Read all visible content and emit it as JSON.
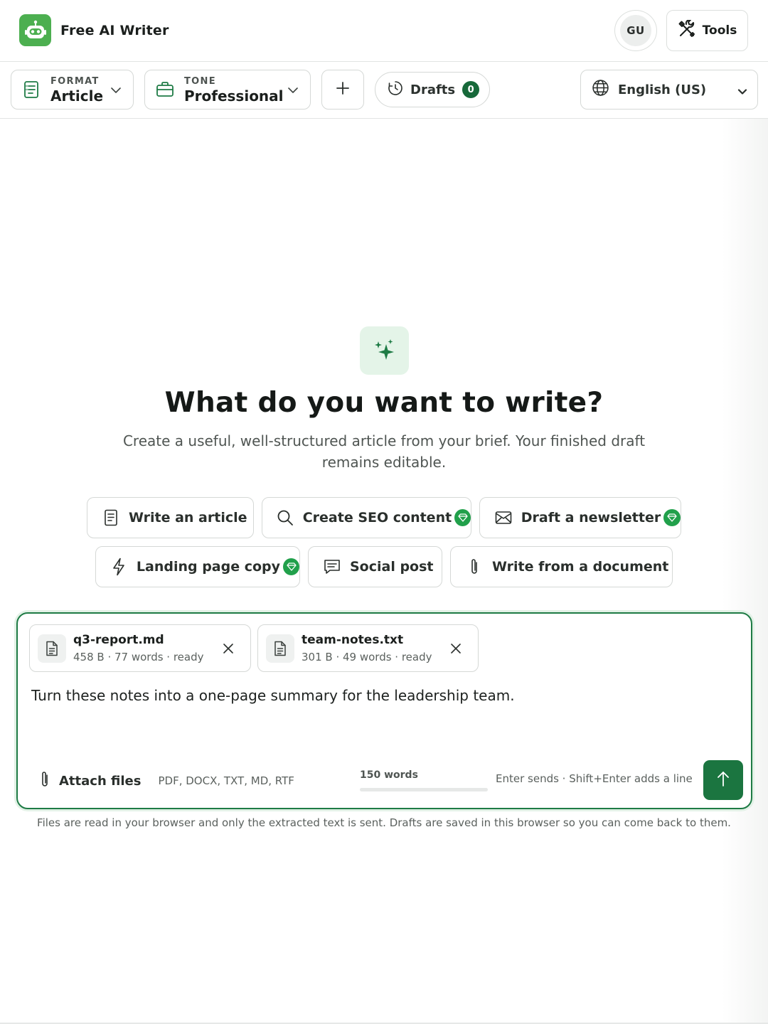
{
  "header": {
    "app_name": "Free AI Writer",
    "avatar_initials": "GU",
    "tools_label": "Tools",
    "brand_color": "#4caf50"
  },
  "toolbar": {
    "format": {
      "label": "FORMAT",
      "value": "Article"
    },
    "tone": {
      "label": "TONE",
      "value": "Professional"
    },
    "drafts": {
      "label": "Drafts",
      "count": "0"
    },
    "language": {
      "value": "English (US)"
    }
  },
  "hero": {
    "title": "What do you want to write?",
    "subtitle": "Create a useful, well-structured article from your brief. Your finished draft remains editable."
  },
  "suggestions": [
    {
      "label": "Write an article",
      "icon": "document-icon",
      "premium": false
    },
    {
      "label": "Create SEO content",
      "icon": "search-icon",
      "premium": true
    },
    {
      "label": "Draft a newsletter",
      "icon": "envelope-icon",
      "premium": true
    },
    {
      "label": "Landing page copy",
      "icon": "bolt-icon",
      "premium": true
    },
    {
      "label": "Social post",
      "icon": "message-icon",
      "premium": false
    },
    {
      "label": "Write from a document",
      "icon": "paperclip-icon",
      "premium": false
    }
  ],
  "composer": {
    "files": [
      {
        "name": "q3-report.md",
        "meta": "458 B · 77 words · ready"
      },
      {
        "name": "team-notes.txt",
        "meta": "301 B · 49 words · ready"
      }
    ],
    "prompt": "Turn these notes into a one-page summary for the leadership team.",
    "attach_label": "Attach files",
    "attach_types": "PDF, DOCX, TXT, MD, RTF",
    "word_target": "150 words",
    "word_progress": 0,
    "hint": "Enter sends · Shift+Enter adds a line",
    "accent_color": "#1b7540"
  },
  "privacy_note": "Files are read in your browser and only the extracted text is sent. Drafts are saved in this browser so you can come back to them."
}
